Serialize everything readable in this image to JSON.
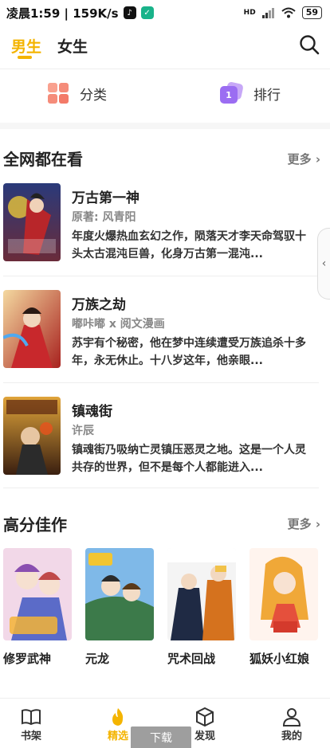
{
  "status_bar": {
    "time_speed": "凌晨1:59 | 159K/s",
    "network": "HD",
    "battery": "59"
  },
  "top_tabs": [
    "男生",
    "女生"
  ],
  "categories": [
    {
      "label": "分类",
      "icon": "grid-icon"
    },
    {
      "label": "排行",
      "icon": "rank-icon",
      "badge": "1"
    }
  ],
  "section_hot": {
    "title": "全网都在看",
    "more": "更多",
    "books": [
      {
        "title": "万古第一神",
        "author": "原著: 风青阳",
        "desc": "年度火爆热血玄幻之作，陨落天才李天命驾驭十头太古混沌巨兽，化身万古第一混沌..."
      },
      {
        "title": "万族之劫",
        "author": "嘟咔嘟 x 阅文漫画",
        "desc": "苏宇有个秘密，他在梦中连续遭受万族追杀十多年，永无休止。十八岁这年，他亲眼..."
      },
      {
        "title": "镇魂街",
        "author": "许辰",
        "desc": "镇魂街乃吸纳亡灵镇压恶灵之地。这是一个人灵共存的世界，但不是每个人都能进入..."
      }
    ]
  },
  "section_high": {
    "title": "高分佳作",
    "more": "更多",
    "items": [
      "修罗武神",
      "元龙",
      "咒术回战",
      "狐妖小红娘"
    ]
  },
  "bottom_nav": [
    {
      "label": "书架",
      "icon": "book-icon"
    },
    {
      "label": "精选",
      "icon": "flame-icon",
      "active": true
    },
    {
      "label": "发现",
      "icon": "cube-icon"
    },
    {
      "label": "我的",
      "icon": "user-icon"
    }
  ],
  "download_button": "下载",
  "colors": {
    "accent": "#f4b400"
  }
}
